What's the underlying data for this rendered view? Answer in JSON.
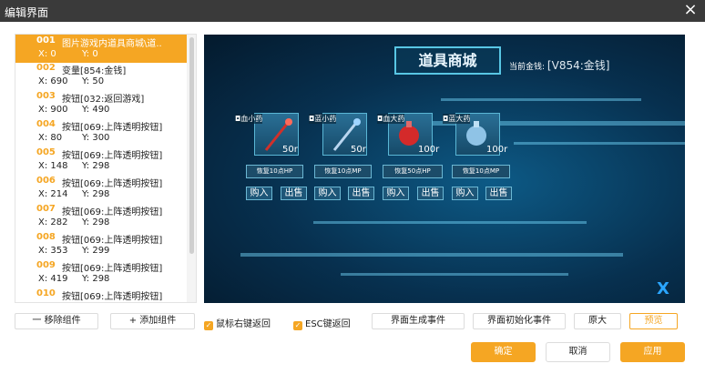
{
  "window": {
    "title": "编辑界面",
    "close_icon": "×"
  },
  "components": [
    {
      "num": "001",
      "name": "图片游戏内道具商城\\道..",
      "x": "X: 0",
      "y": "Y: 0",
      "selected": true
    },
    {
      "num": "002",
      "name": "变量[854:金钱]",
      "x": "X: 690",
      "y": "Y: 50"
    },
    {
      "num": "003",
      "name": "按钮[032:返回游戏]",
      "x": "X: 900",
      "y": "Y: 490"
    },
    {
      "num": "004",
      "name": "按钮[069:上阵透明按钮]",
      "x": "X: 80",
      "y": "Y: 300"
    },
    {
      "num": "005",
      "name": "按钮[069:上阵透明按钮]",
      "x": "X: 148",
      "y": "Y: 298"
    },
    {
      "num": "006",
      "name": "按钮[069:上阵透明按钮]",
      "x": "X: 214",
      "y": "Y: 298"
    },
    {
      "num": "007",
      "name": "按钮[069:上阵透明按钮]",
      "x": "X: 282",
      "y": "Y: 298"
    },
    {
      "num": "008",
      "name": "按钮[069:上阵透明按钮]",
      "x": "X: 353",
      "y": "Y: 299"
    },
    {
      "num": "009",
      "name": "按钮[069:上阵透明按钮]",
      "x": "X: 419",
      "y": "Y: 298"
    },
    {
      "num": "010",
      "name": "按钮[069:上阵透明按钮]",
      "x": "",
      "y": ""
    }
  ],
  "preview": {
    "shop_title": "道具商城",
    "coins_label": "当前金钱:",
    "coins_value": "[V854:金钱]",
    "items": [
      {
        "tag": "◘血小药",
        "price": "50r",
        "desc": "恢复10点HP",
        "buy": "购入",
        "sell": "出售"
      },
      {
        "tag": "◘蓝小药",
        "price": "50r",
        "desc": "恢复10点MP",
        "buy": "购入",
        "sell": "出售"
      },
      {
        "tag": "◘血大药",
        "price": "100r",
        "desc": "恢复50点HP",
        "buy": "购入",
        "sell": "出售"
      },
      {
        "tag": "◘蓝大药",
        "price": "100r",
        "desc": "恢复10点MP",
        "buy": "购入",
        "sell": "出售"
      }
    ],
    "logo": "X"
  },
  "toolbar": {
    "remove": "一 移除组件",
    "add": "+ 添加组件",
    "right_click_back": "鼠标右键返回",
    "esc_back": "ESC键返回",
    "gen_event": "界面生成事件",
    "init_event": "界面初始化事件",
    "original": "原大",
    "preview": "预览"
  },
  "footer": {
    "ok": "确定",
    "cancel": "取消",
    "apply": "应用"
  },
  "colors": {
    "accent": "#f5a623",
    "titlebar": "#3a3a3a"
  }
}
